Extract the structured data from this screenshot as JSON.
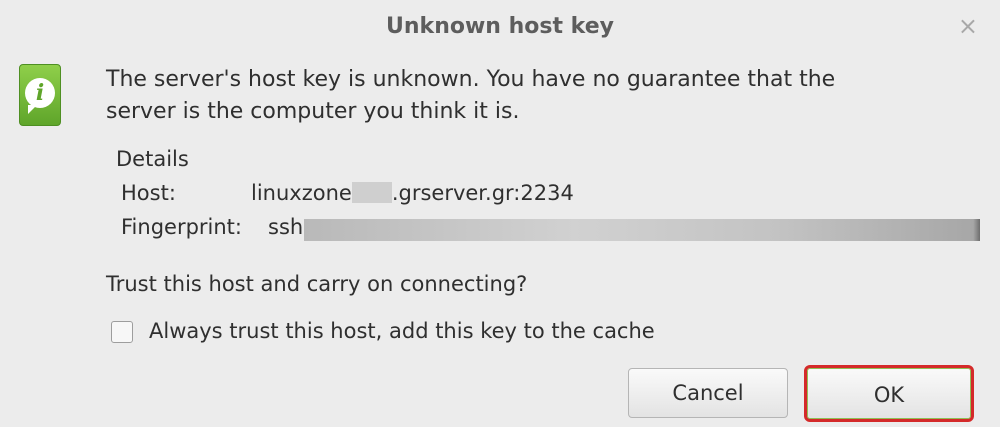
{
  "dialog": {
    "title": "Unknown host key",
    "close_symbol": "×",
    "message": "The server's host key is unknown. You have no guarantee that the server is the computer you think it is.",
    "details": {
      "title": "Details",
      "host_label": "Host:",
      "host_prefix": "linuxzone",
      "host_suffix": ".grserver.gr:2234",
      "fingerprint_label": "Fingerprint:",
      "fingerprint_prefix": "ssh-"
    },
    "question": "Trust this host and carry on connecting?",
    "checkbox_label": "Always trust this host, add this key to the cache",
    "buttons": {
      "cancel": "Cancel",
      "ok": "OK"
    }
  },
  "icons": {
    "info": "info-icon"
  },
  "colors": {
    "icon_green": "#5fa52a",
    "ok_highlight": "#d42a2a"
  }
}
